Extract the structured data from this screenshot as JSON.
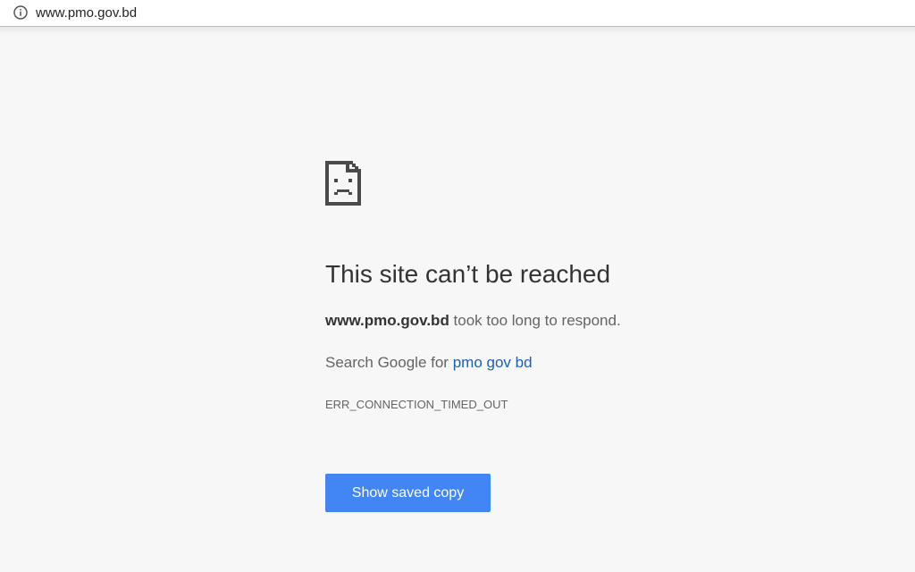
{
  "address_bar": {
    "url": "www.pmo.gov.bd",
    "info_icon": "info-icon"
  },
  "error_page": {
    "icon": "sad-document-icon",
    "title": "This site can’t be reached",
    "host": "www.pmo.gov.bd",
    "message_suffix": " took too long to respond.",
    "search_prefix": "Search Google for ",
    "search_query": "pmo gov bd",
    "error_code": "ERR_CONNECTION_TIMED_OUT",
    "button_label": "Show saved copy"
  },
  "colors": {
    "background": "#f7f7f7",
    "button": "#4285f4",
    "link": "#1f5fb0"
  }
}
